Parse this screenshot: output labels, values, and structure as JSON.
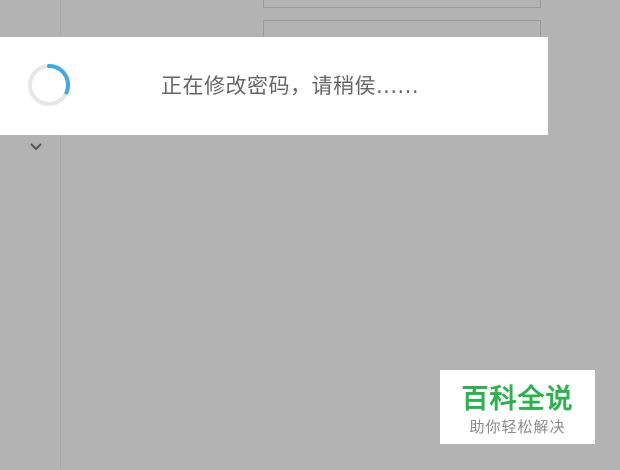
{
  "loading_toast": {
    "message": "正在修改密码，请稍侯......"
  },
  "icons": {
    "spinner": "spinner-icon",
    "chevron": "chevron-down-icon"
  },
  "colors": {
    "overlay": "#b3b3b3",
    "spinner_active": "#3fa9e6",
    "spinner_track": "#e6e6e6",
    "message_text": "#666666",
    "watermark_brand": "#2bb24c"
  },
  "watermark": {
    "brand": "百科全说",
    "slogan": "助你轻松解决"
  }
}
